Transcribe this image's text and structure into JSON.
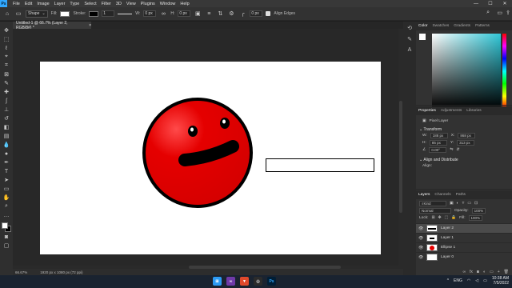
{
  "app": {
    "logo": "Ps",
    "menu": [
      "File",
      "Edit",
      "Image",
      "Layer",
      "Type",
      "Select",
      "Filter",
      "3D",
      "View",
      "Plugins",
      "Window",
      "Help"
    ],
    "window_controls": [
      "—",
      "☐",
      "✕"
    ]
  },
  "options": {
    "shape_mode": "Shape",
    "fill_label": "Fill:",
    "stroke_label": "Stroke:",
    "stroke_width": "1",
    "w_label": "W:",
    "w_value": "0 px",
    "h_label": "H:",
    "h_value": "0 px",
    "radius_value": "0 px",
    "align_edges": "Align Edges"
  },
  "document": {
    "tab_title": "Untitled-1 @ 66.7% (Layer 2, RGB/8#) *",
    "tab_close": "×"
  },
  "status": {
    "zoom": "66.67%",
    "doc_info": "1920 px x 1080 px (72 ppi)"
  },
  "color_panel": {
    "tabs": [
      "Color",
      "Swatches",
      "Gradients",
      "Patterns"
    ],
    "active_tab": "Color"
  },
  "properties_panel": {
    "tabs": [
      "Properties",
      "Adjustments",
      "Libraries"
    ],
    "layer_type": "Pixel Layer",
    "transform_label": "Transform",
    "w_label": "W:",
    "w_value": "188 px",
    "h_label": "H:",
    "h_value": "85 px",
    "x_label": "X:",
    "x_value": "868 px",
    "y_label": "Y:",
    "y_value": "313 px",
    "angle_value": "0.00°",
    "align_label": "Align and Distribute",
    "align_sub": "Align:"
  },
  "layers_panel": {
    "tabs": [
      "Layers",
      "Channels",
      "Paths"
    ],
    "kind": "Kind",
    "blend_mode": "Normal",
    "opacity_label": "Opacity:",
    "opacity_value": "100%",
    "lock_label": "Lock:",
    "fill_label": "Fill:",
    "fill_value": "100%",
    "layers": [
      {
        "name": "Layer 2",
        "selected": true
      },
      {
        "name": "Layer 1",
        "selected": false
      },
      {
        "name": "Ellipse 1",
        "selected": false
      },
      {
        "name": "Layer 0",
        "selected": false
      }
    ]
  },
  "taskbar": {
    "language": "ENG",
    "time": "10:38 AM",
    "date": "7/5/2022",
    "ps_label": "Ps"
  },
  "colors": {
    "face_red": "#e50000",
    "canvas_bg": "#ffffff",
    "accent_ps": "#31a8ff"
  }
}
